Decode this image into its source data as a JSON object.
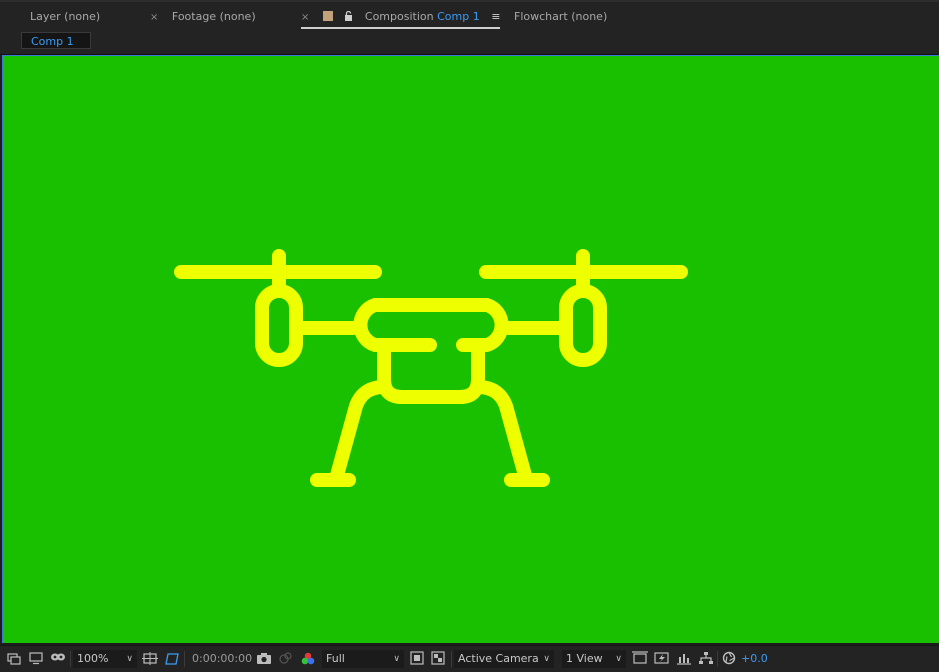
{
  "tabs": [
    {
      "label": "Layer",
      "value": "(none)"
    },
    {
      "label": "Footage",
      "value": "(none)",
      "close": "×"
    },
    {
      "label": "Composition",
      "value": "Comp 1",
      "close": "×",
      "menu": "≡"
    },
    {
      "label": "Flowchart",
      "value": "(none)"
    }
  ],
  "comp_chip": "Comp 1",
  "viewer": {
    "background": "#19c000",
    "drone_color": "#eeff00"
  },
  "toolbar": {
    "zoom": "100%",
    "timecode": "0:00:00:00",
    "resolution": "Full",
    "camera": "Active Camera",
    "views": "1 View",
    "exposure": "+0.0"
  },
  "icons": [
    "always-preview-icon",
    "monitor-icon",
    "mask-icon",
    "safe-zones-icon",
    "region-of-interest-icon",
    "snapshot-icon",
    "show-snapshot-icon",
    "color-channels-icon",
    "transparency-grid-icon",
    "pixel-aspect-icon",
    "reset-view-icon",
    "fast-preview-icon",
    "timeline-icon",
    "flowchart-icon",
    "reset-exposure-icon"
  ]
}
